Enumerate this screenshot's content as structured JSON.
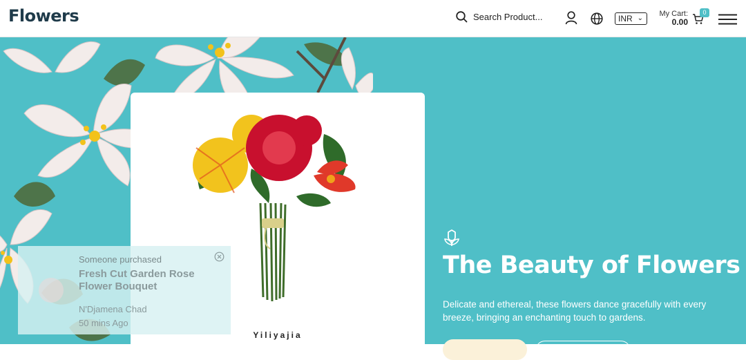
{
  "header": {
    "logo": "Flowers",
    "search_placeholder": "Search Product...",
    "currency": "INR",
    "cart_label": "My Cart:",
    "cart_amount": "0.00",
    "cart_count": "0"
  },
  "product_card": {
    "vendor": "Yiliyajia"
  },
  "toast": {
    "label": "Someone purchased",
    "product_name": "Fresh Cut Garden Rose Flower Bouquet",
    "location": "N'Djamena Chad",
    "time": "50 mins Ago"
  },
  "hero": {
    "title": "The Beauty of Flowers",
    "description": "Delicate and ethereal, these flowers dance gracefully with every breeze, bringing an enchanting touch to gardens."
  },
  "icons": {
    "search": "search-icon",
    "account": "user-icon",
    "language": "globe-icon",
    "cart": "cart-icon",
    "menu": "hamburger-menu-icon",
    "close": "close-circle-icon",
    "brand_mark": "flower-leaf-icon"
  },
  "colors": {
    "brand_teal": "#4fbfc7",
    "logo": "#1f3b4a",
    "button_cream": "#fbf1d9"
  }
}
